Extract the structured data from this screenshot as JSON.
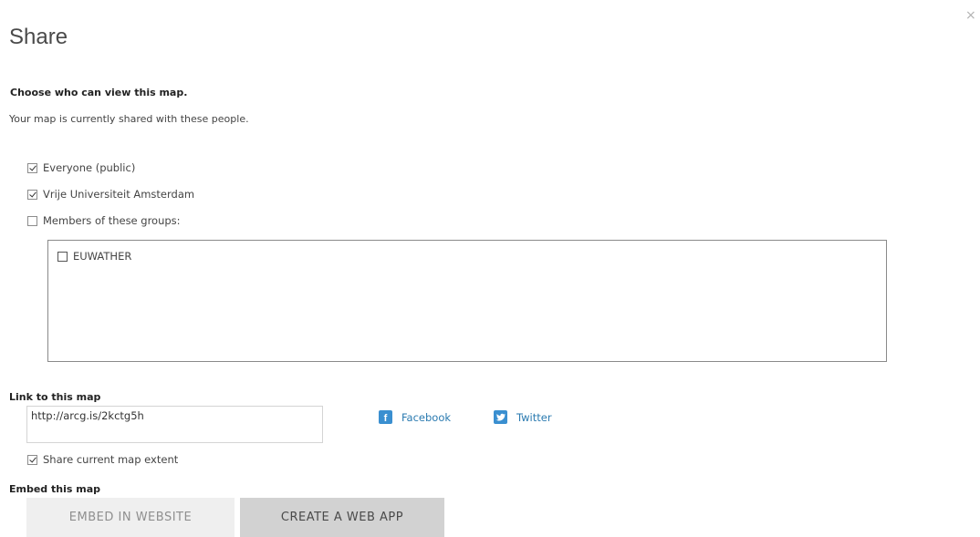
{
  "dialog": {
    "title": "Share",
    "close_glyph": "×"
  },
  "visibility": {
    "heading": "Choose who can view this map.",
    "subtext": "Your map is currently shared with these people.",
    "options": [
      {
        "label": "Everyone (public)",
        "checked": true
      },
      {
        "label": "Vrije Universiteit Amsterdam",
        "checked": true
      },
      {
        "label": "Members of these groups:",
        "checked": false
      }
    ],
    "groups": [
      {
        "label": "EUWATHER",
        "checked": false
      }
    ]
  },
  "link": {
    "heading": "Link to this map",
    "url": "http://arcg.is/2kctg5h",
    "share_extent_label": "Share current map extent",
    "share_extent_checked": true
  },
  "social": {
    "facebook_label": "Facebook",
    "facebook_icon": "facebook-icon",
    "twitter_label": "Twitter",
    "twitter_icon": "twitter-icon",
    "brand_color": "#3a8fd0",
    "link_color": "#2a7ab0"
  },
  "embed": {
    "heading": "Embed this map",
    "embed_button": "EMBED IN WEBSITE",
    "webapp_button": "CREATE A WEB APP"
  }
}
